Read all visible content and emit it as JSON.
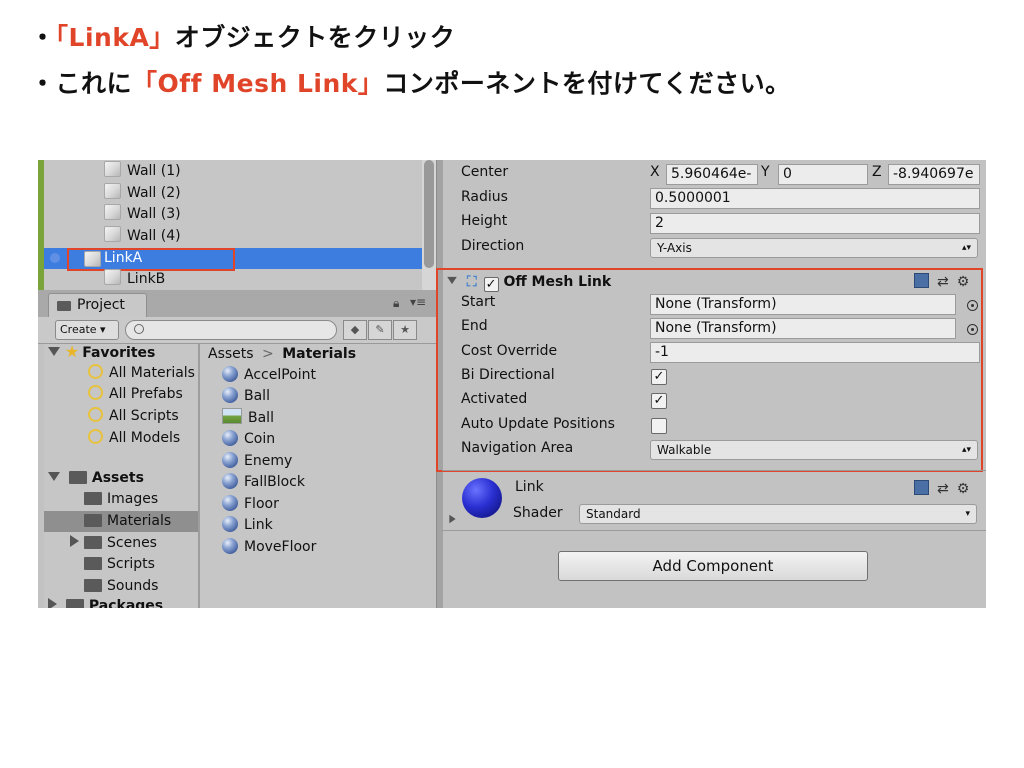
{
  "slide": {
    "line1": {
      "bullet": "・",
      "highlight": "「LinkA」",
      "rest": "オブジェクトをクリック"
    },
    "line2": {
      "bullet": "・",
      "pre": "これに",
      "highlight": "「Off Mesh Link」",
      "rest": "コンポーネントを付けてください。"
    },
    "highlight_color": "#e0452a"
  },
  "hierarchy": {
    "items": [
      "Wall (1)",
      "Wall (2)",
      "Wall (3)",
      "Wall (4)",
      "LinkA",
      "LinkB"
    ],
    "selected": "LinkA"
  },
  "project": {
    "tab_label": "Project",
    "create_label": "Create ▾",
    "favorites": {
      "label": "Favorites",
      "items": [
        "All Materials",
        "All Prefabs",
        "All Scripts",
        "All Models"
      ]
    },
    "assets": {
      "label": "Assets",
      "folders": [
        "Images",
        "Materials",
        "Scenes",
        "Scripts",
        "Sounds"
      ]
    },
    "packages_label": "Packages",
    "breadcrumb": {
      "root": "Assets",
      "sep": ">",
      "current": "Materials"
    },
    "materials": [
      "AccelPoint",
      "Ball",
      "Ball",
      "Coin",
      "Enemy",
      "FallBlock",
      "Floor",
      "Link",
      "MoveFloor"
    ]
  },
  "inspector": {
    "collider": {
      "center_label": "Center",
      "center": {
        "x_label": "X",
        "x": "5.960464e-",
        "y_label": "Y",
        "y": "0",
        "z_label": "Z",
        "z": "-8.940697e"
      },
      "radius_label": "Radius",
      "radius": "0.5000001",
      "height_label": "Height",
      "height": "2",
      "direction_label": "Direction",
      "direction": "Y-Axis"
    },
    "off_mesh_link": {
      "title": "Off Mesh Link",
      "start_label": "Start",
      "start": "None (Transform)",
      "end_label": "End",
      "end": "None (Transform)",
      "cost_label": "Cost Override",
      "cost": "-1",
      "bidir_label": "Bi Directional",
      "bidir": true,
      "activated_label": "Activated",
      "activated": true,
      "auto_update_label": "Auto Update Positions",
      "auto_update": false,
      "nav_area_label": "Navigation Area",
      "nav_area": "Walkable"
    },
    "material": {
      "name": "Link",
      "shader_label": "Shader",
      "shader": "Standard"
    },
    "add_component_label": "Add Component"
  }
}
